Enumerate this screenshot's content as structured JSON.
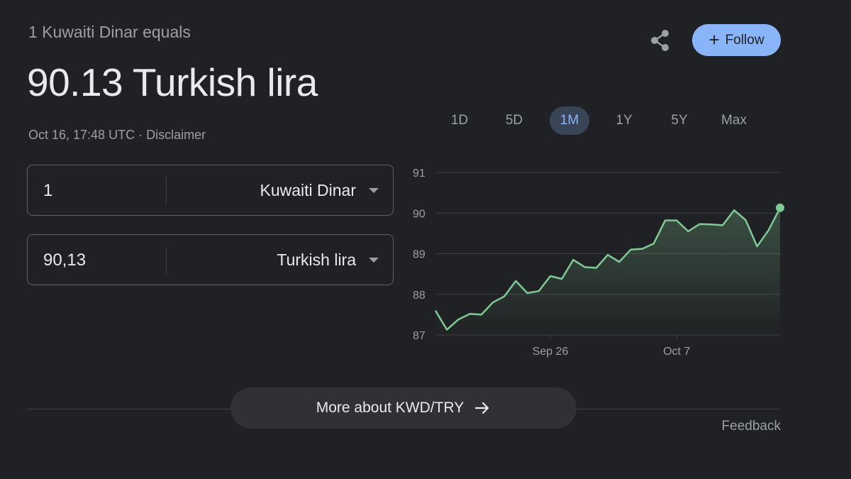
{
  "header": {
    "subtitle": "1 Kuwaiti Dinar equals",
    "rate_text": "90.13 Turkish lira",
    "timestamp": "Oct 16, 17:48 UTC",
    "disclaimer": "Disclaimer",
    "separator": " · "
  },
  "actions": {
    "share_icon": "share-icon",
    "follow_label": "Follow",
    "follow_icon": "plus-icon"
  },
  "converter": {
    "from": {
      "value": "1",
      "currency": "Kuwaiti Dinar"
    },
    "to": {
      "value": "90,13",
      "currency": "Turkish lira"
    }
  },
  "ranges": [
    "1D",
    "5D",
    "1M",
    "1Y",
    "5Y",
    "Max"
  ],
  "active_range": "1M",
  "colors": {
    "background": "#202124",
    "accent": "#8ab4f8",
    "line": "#81c995",
    "grid": "#3c4043"
  },
  "chart_data": {
    "type": "line",
    "y_ticks": [
      87,
      88,
      89,
      90,
      91
    ],
    "ylim": [
      87,
      91
    ],
    "x_ticks": [
      {
        "label": "Sep 26",
        "index": 10
      },
      {
        "label": "Oct 7",
        "index": 21
      }
    ],
    "series": [
      {
        "values": [
          87.6,
          87.13,
          87.38,
          87.52,
          87.5,
          87.8,
          87.95,
          88.33,
          88.03,
          88.08,
          88.45,
          88.38,
          88.85,
          88.67,
          88.65,
          88.97,
          88.8,
          89.1,
          89.12,
          89.25,
          89.82,
          89.82,
          89.55,
          89.73,
          89.72,
          89.7,
          90.07,
          89.83,
          89.18,
          89.58,
          90.13
        ]
      }
    ],
    "grid": true
  },
  "footer": {
    "more_label": "More about KWD/TRY",
    "more_icon": "arrow-right-icon",
    "feedback": "Feedback"
  }
}
